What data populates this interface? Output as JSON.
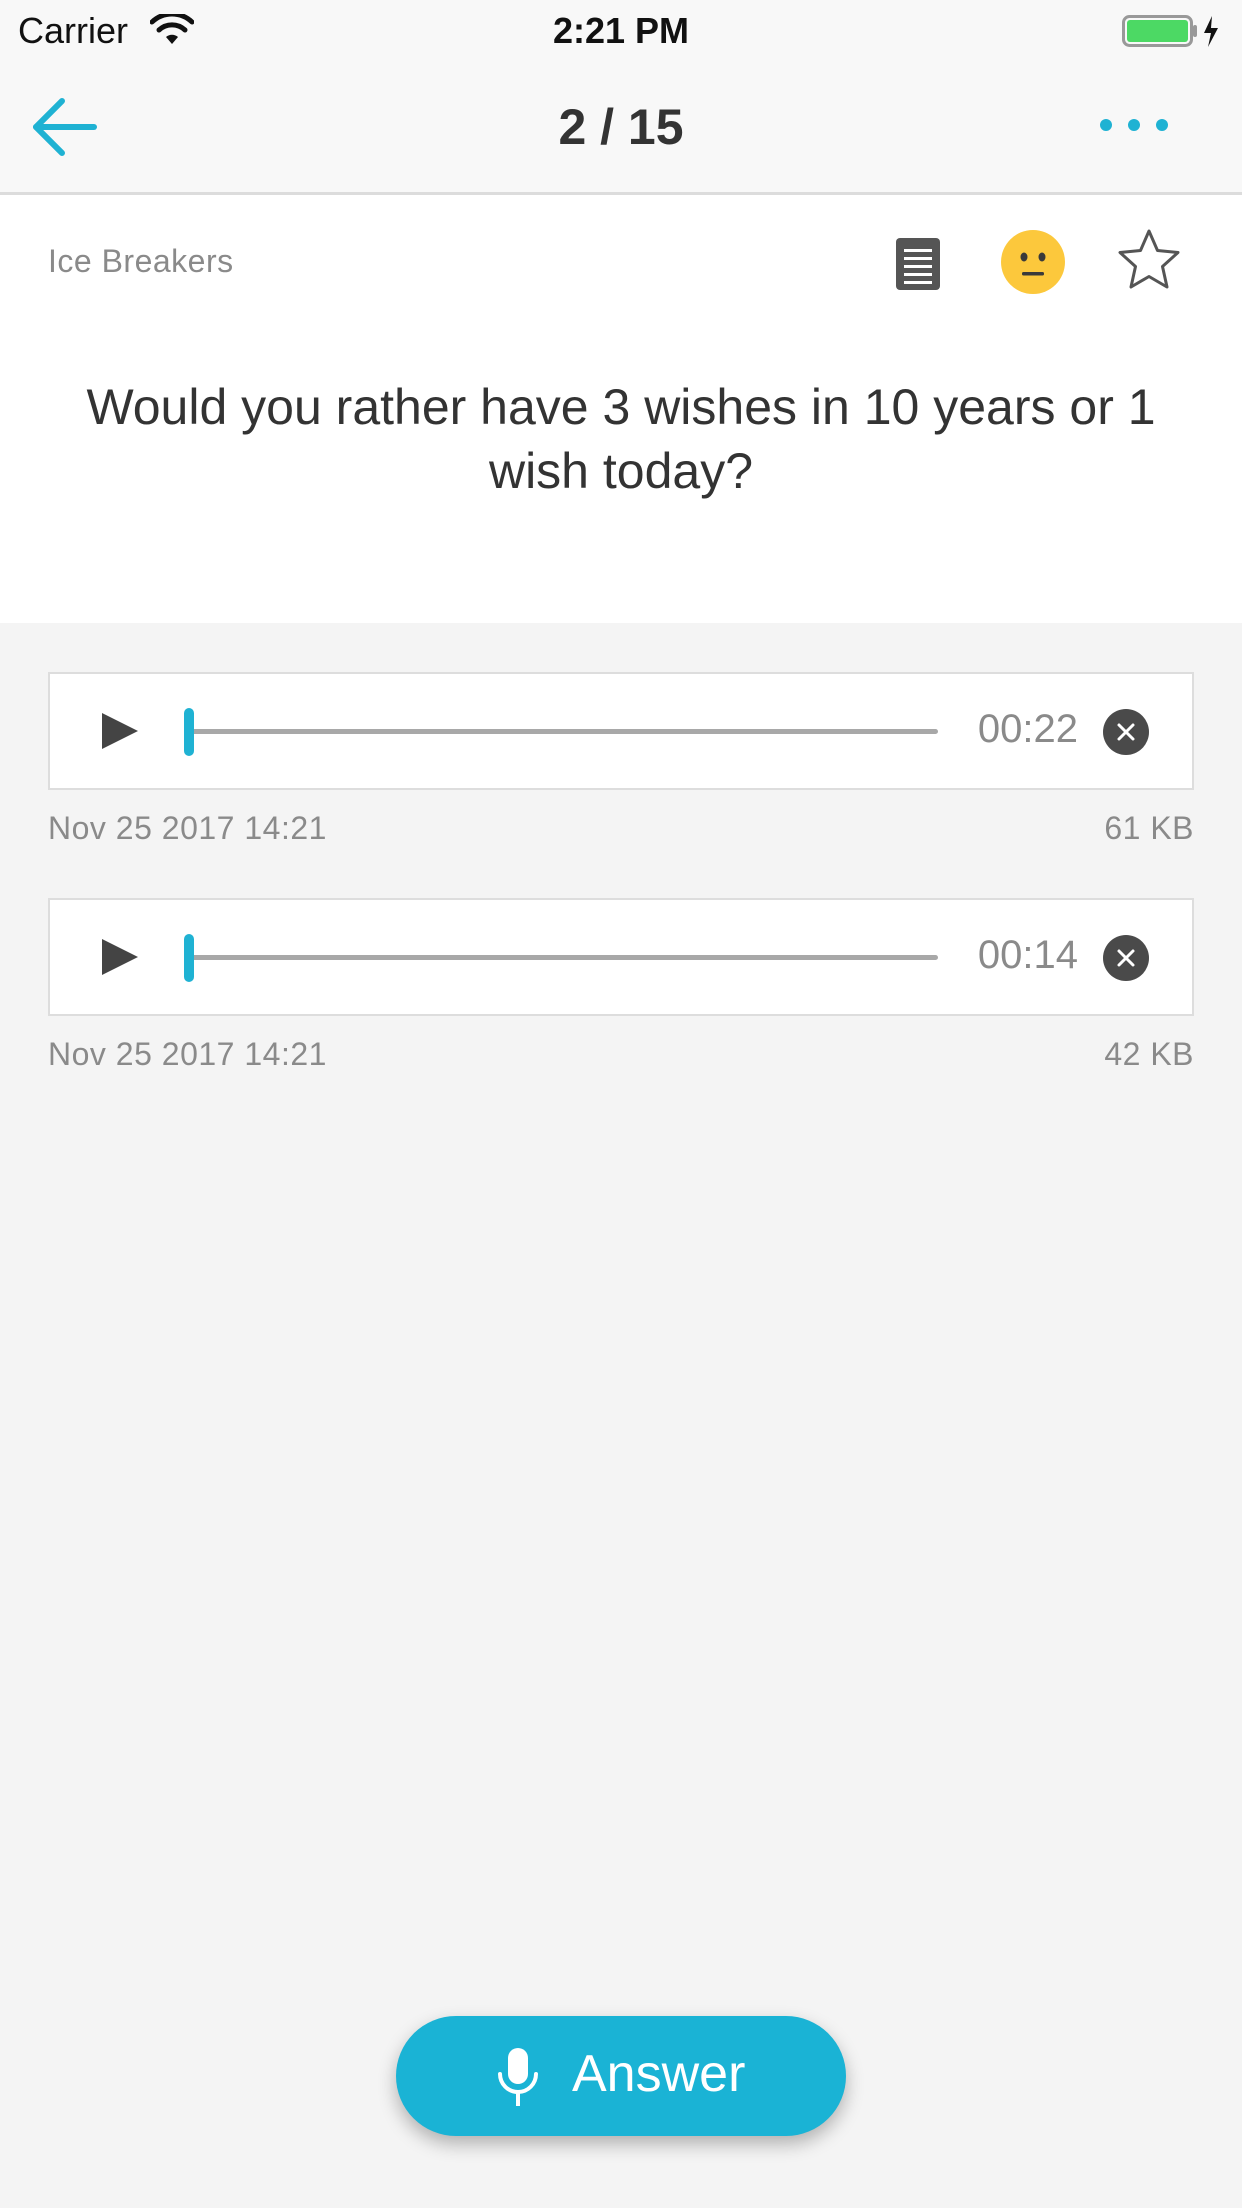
{
  "status_bar": {
    "carrier": "Carrier",
    "time": "2:21 PM",
    "wifi_icon": "wifi-icon",
    "battery_icon": "battery-charging-icon",
    "battery_color": "#4cd964"
  },
  "nav": {
    "back_icon": "arrow-left-icon",
    "title": "2 / 15",
    "more_icon": "more-dots-icon",
    "accent_color": "#1fb2d3"
  },
  "question": {
    "category": "Ice Breakers",
    "text": "Would you rather have 3 wishes in 10 years or 1 wish today?",
    "icons": [
      "notes-icon",
      "neutral-face-icon",
      "star-outline-icon"
    ],
    "mood_color": "#fcc83c"
  },
  "recordings": [
    {
      "duration": "00:22",
      "date": "Nov 25 2017 14:21",
      "size": "61 KB",
      "progress": 0
    },
    {
      "duration": "00:14",
      "date": "Nov 25 2017 14:21",
      "size": "42 KB",
      "progress": 0
    }
  ],
  "answer_button": {
    "label": "Answer",
    "icon": "microphone-icon",
    "color": "#1ab3d5"
  }
}
